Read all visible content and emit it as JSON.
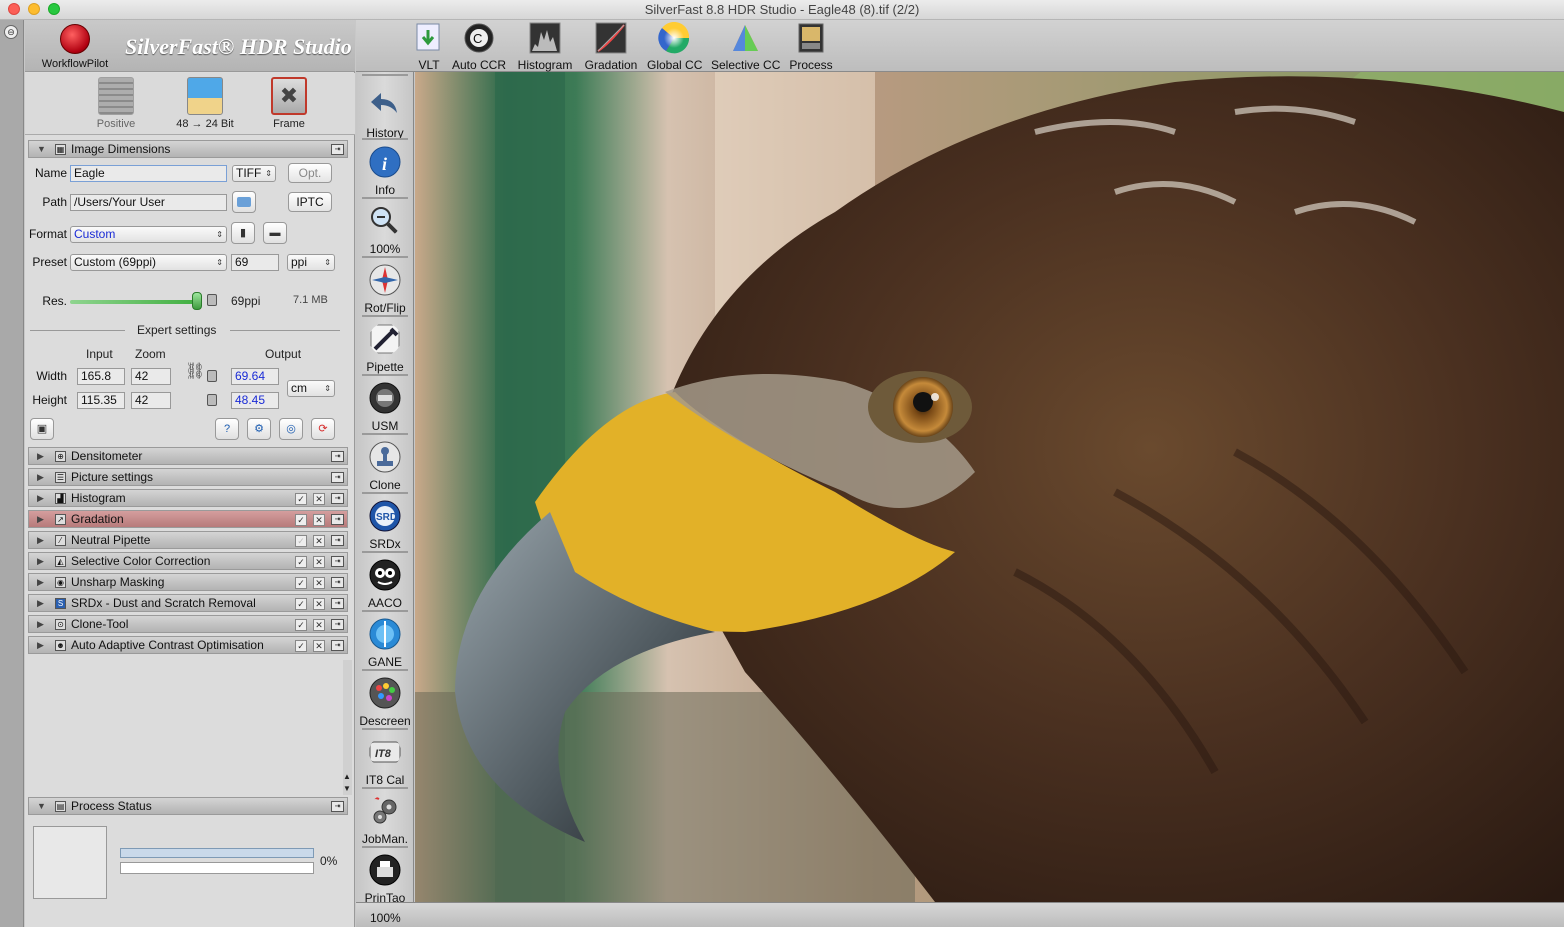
{
  "window": {
    "title": "SilverFast 8.8 HDR Studio - Eagle48 (8).tif (2/2)"
  },
  "logo": {
    "workflow_label": "WorkflowPilot",
    "brand": "SilverFast® HDR Studio"
  },
  "modes": [
    {
      "label": "Positive",
      "icon": "film-strip-icon"
    },
    {
      "label": "48 → 24 Bit",
      "icon": "palm-beach-icon"
    },
    {
      "label": "Frame",
      "icon": "frame-tools-icon"
    }
  ],
  "image_dimensions": {
    "header": "Image Dimensions",
    "name_label": "Name",
    "name_value": "Eagle",
    "filetype": "TIFF",
    "opt_button": "Opt.",
    "path_label": "Path",
    "path_value": "/Users/Your User",
    "iptc_button": "IPTC",
    "format_label": "Format",
    "format_value": "Custom",
    "preset_label": "Preset",
    "preset_value": "Custom (69ppi)",
    "preset_number": "69",
    "preset_unit": "ppi",
    "res_label": "Res.",
    "res_value": "69ppi",
    "file_size": "7.1 MB",
    "expert_settings": "Expert settings",
    "col_input": "Input",
    "col_zoom": "Zoom",
    "col_output": "Output",
    "width_label": "Width",
    "width_input": "165.8",
    "width_zoom": "42",
    "width_output": "69.64",
    "height_label": "Height",
    "height_input": "115.35",
    "height_zoom": "42",
    "height_output": "48.45",
    "output_unit": "cm",
    "res_slider_fraction": 0.97
  },
  "sections": [
    {
      "label": "Densitometer",
      "icon": "crosshair-icon",
      "checks": false,
      "highlight": false
    },
    {
      "label": "Picture settings",
      "icon": "list-icon",
      "checks": false,
      "highlight": false
    },
    {
      "label": "Histogram",
      "icon": "histogram-icon",
      "checks": true,
      "highlight": false
    },
    {
      "label": "Gradation",
      "icon": "gradation-icon",
      "checks": true,
      "highlight": true
    },
    {
      "label": "Neutral Pipette",
      "icon": "pipette-icon",
      "checks": true,
      "highlight": false
    },
    {
      "label": "Selective Color Correction",
      "icon": "triangle-color-icon",
      "checks": true,
      "highlight": false
    },
    {
      "label": "Unsharp Masking",
      "icon": "usm-icon",
      "checks": true,
      "highlight": false
    },
    {
      "label": "SRDx - Dust and Scratch Removal",
      "icon": "srdx-icon",
      "checks": true,
      "highlight": false
    },
    {
      "label": "Clone-Tool",
      "icon": "clone-icon",
      "checks": true,
      "highlight": false
    },
    {
      "label": "Auto Adaptive Contrast Optimisation",
      "icon": "aaco-icon",
      "checks": true,
      "highlight": false
    }
  ],
  "process_status": {
    "header": "Process Status",
    "percent": "0%",
    "progress": 0
  },
  "toolbar": [
    {
      "label": "VLT",
      "icon": "vlt-icon"
    },
    {
      "label": "Auto CCR",
      "icon": "auto-ccr-icon"
    },
    {
      "label": "Histogram",
      "icon": "histogram-icon"
    },
    {
      "label": "Gradation",
      "icon": "gradation-icon"
    },
    {
      "label": "Global CC",
      "icon": "color-wheel-icon"
    },
    {
      "label": "Selective CC",
      "icon": "selective-cc-icon"
    },
    {
      "label": "Process",
      "icon": "process-icon"
    }
  ],
  "vtools": [
    {
      "label": "History",
      "icon": "undo-arrow-icon"
    },
    {
      "label": "Info",
      "icon": "info-icon"
    },
    {
      "label": "100%",
      "icon": "magnifier-icon"
    },
    {
      "label": "Rot/Flip",
      "icon": "compass-icon"
    },
    {
      "label": "Pipette",
      "icon": "pipette-icon"
    },
    {
      "label": "USM",
      "icon": "usm-icon"
    },
    {
      "label": "Clone",
      "icon": "clone-stamp-icon"
    },
    {
      "label": "SRDx",
      "icon": "srdx-icon"
    },
    {
      "label": "AACO",
      "icon": "aaco-icon"
    },
    {
      "label": "GANE",
      "icon": "gane-icon"
    },
    {
      "label": "Descreen",
      "icon": "descreen-icon"
    },
    {
      "label": "IT8 Cal",
      "icon": "it8-icon"
    },
    {
      "label": "JobMan.",
      "icon": "gears-icon"
    },
    {
      "label": "PrinTao",
      "icon": "printer-icon"
    }
  ],
  "statusbar": {
    "zoom": "100%"
  },
  "colors": {
    "accent_blue": "#1a2bd6",
    "highlight_red": "#c47f7f",
    "slider_green": "#3fae3f"
  }
}
